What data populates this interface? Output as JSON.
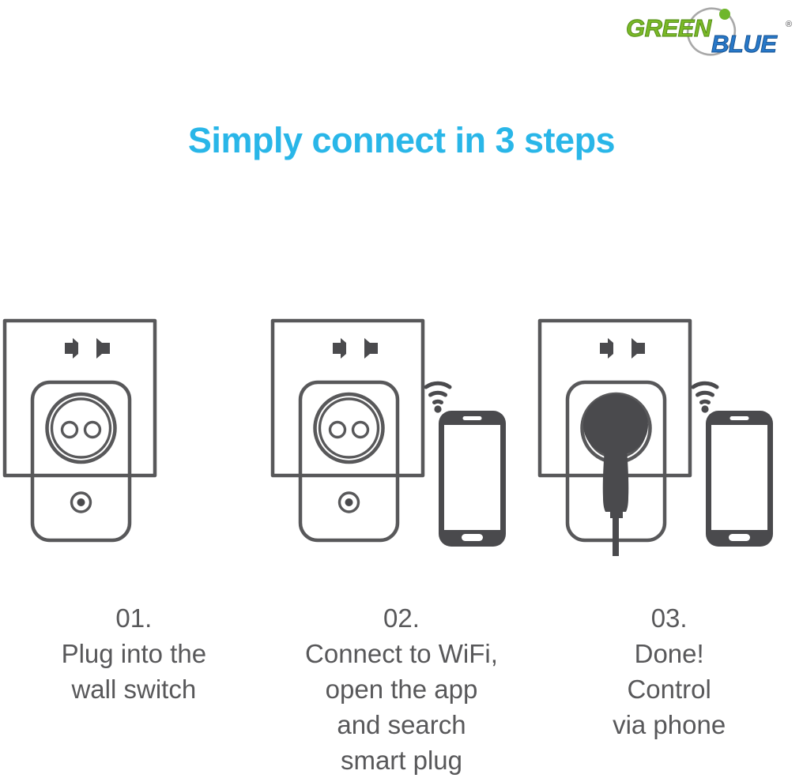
{
  "brand": {
    "name_part1": "GREEN",
    "name_part2": "BLUE",
    "registered_mark": "®",
    "green_hex": "#7ab828",
    "blue_hex": "#2878c8",
    "swoosh_hex": "#9a9a9a"
  },
  "headline": "Simply connect in 3 steps",
  "headline_color": "#29b6e8",
  "line_color": "#58585a",
  "fill_dark": "#4a4a4d",
  "steps": [
    {
      "number": "01.",
      "lines": [
        "Plug into the",
        "wall switch"
      ],
      "art": "wall-plate-with-smart-plug",
      "has_phone": false,
      "has_wifi": false,
      "plug_inserted": false
    },
    {
      "number": "02.",
      "lines": [
        "Connect to WiFi,",
        "open the app",
        "and search",
        "smart plug"
      ],
      "art": "wall-plate-with-smart-plug-and-phone",
      "has_phone": true,
      "has_wifi": true,
      "plug_inserted": false
    },
    {
      "number": "03.",
      "lines": [
        "Done!",
        "Control",
        "via phone"
      ],
      "art": "wall-plate-with-plug-inserted-and-phone",
      "has_phone": true,
      "has_wifi": true,
      "plug_inserted": true
    }
  ]
}
